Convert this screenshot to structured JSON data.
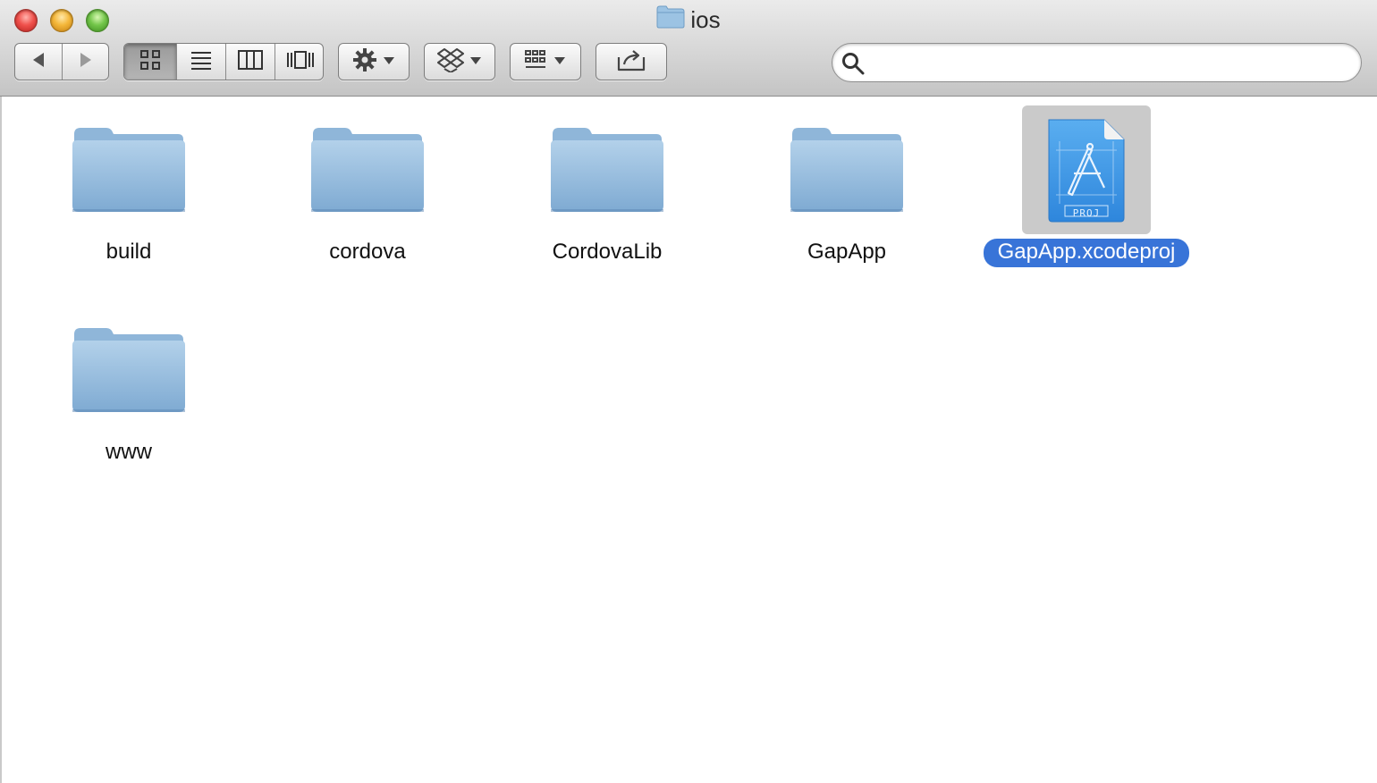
{
  "window": {
    "title": "ios",
    "title_icon": "folder-icon"
  },
  "toolbar": {
    "back_icon": "back-arrow-icon",
    "forward_icon": "forward-arrow-icon",
    "views": [
      "icon-view-icon",
      "list-view-icon",
      "column-view-icon",
      "coverflow-view-icon"
    ],
    "active_view": "icon-view",
    "action_icon": "gear-icon",
    "dropbox_icon": "dropbox-icon",
    "arrange_icon": "arrange-grid-icon",
    "share_icon": "share-icon",
    "search": {
      "value": "",
      "placeholder": ""
    }
  },
  "files": [
    {
      "name": "build",
      "kind": "folder",
      "selected": false
    },
    {
      "name": "cordova",
      "kind": "folder",
      "selected": false
    },
    {
      "name": "CordovaLib",
      "kind": "folder",
      "selected": false
    },
    {
      "name": "GapApp",
      "kind": "folder",
      "selected": false
    },
    {
      "name": "GapApp.xcodeproj",
      "kind": "xcodeproj",
      "badge": "PROJ",
      "selected": true
    },
    {
      "name": "www",
      "kind": "folder",
      "selected": false
    }
  ],
  "colors": {
    "selection": "#3874d8",
    "folder": "#8db8dc",
    "xcodeproj": "#3e9ae8"
  }
}
